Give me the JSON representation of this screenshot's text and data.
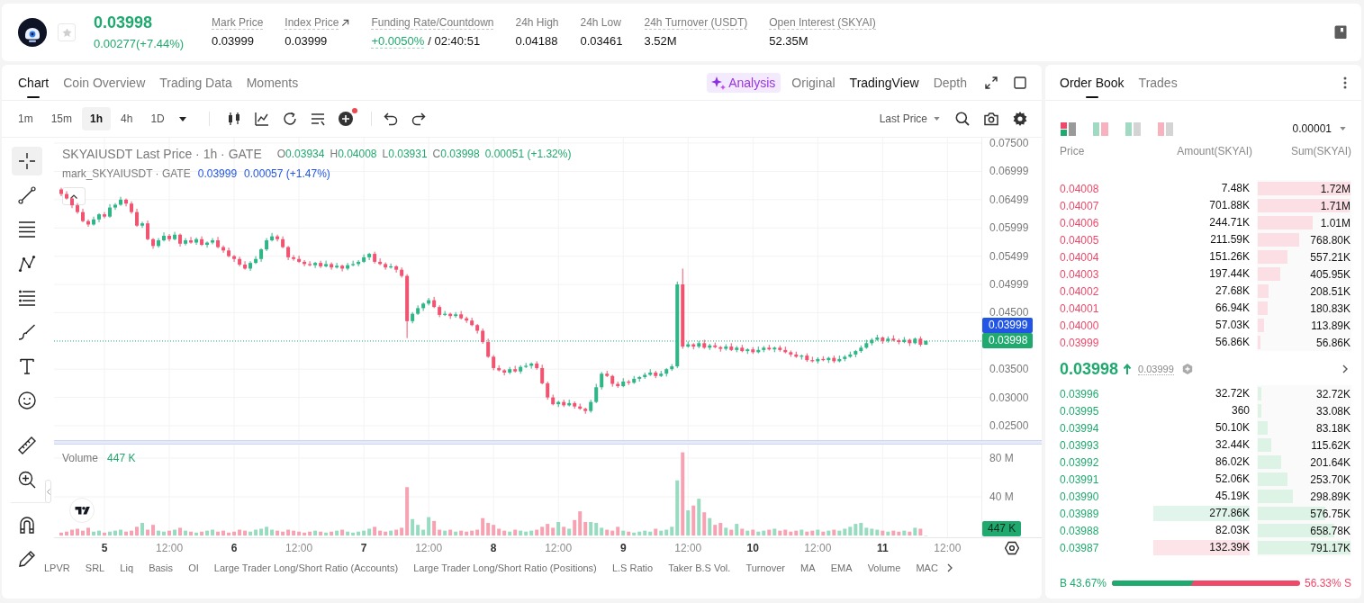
{
  "header": {
    "price": "0.03998",
    "change": "0.00277(+7.44%)",
    "favorite": false,
    "stats": [
      {
        "label": "Mark Price",
        "value": "0.03999",
        "hint": true,
        "kind": "plain"
      },
      {
        "label": "Index Price",
        "value": "0.03999",
        "hint": true,
        "kind": "link"
      },
      {
        "label": "Funding Rate/Countdown",
        "value": "+0.0050%",
        "extra": "/ 02:40:51",
        "hint": true,
        "kind": "funding"
      },
      {
        "label": "24h High",
        "value": "0.04188",
        "hint": false,
        "kind": "plain"
      },
      {
        "label": "24h Low",
        "value": "0.03461",
        "hint": false,
        "kind": "plain"
      },
      {
        "label": "24h Turnover (USDT)",
        "value": "3.52M",
        "hint": true,
        "kind": "plain"
      },
      {
        "label": "Open Interest (SKYAI)",
        "value": "52.35M",
        "hint": true,
        "kind": "plain"
      }
    ]
  },
  "chart_panel": {
    "tabs": [
      {
        "label": "Chart",
        "selected": true
      },
      {
        "label": "Coin Overview",
        "selected": false
      },
      {
        "label": "Trading Data",
        "selected": false
      },
      {
        "label": "Moments",
        "selected": false
      }
    ],
    "views": [
      {
        "label": "Analysis",
        "kind": "ai",
        "selected": false
      },
      {
        "label": "Original",
        "kind": "plain",
        "selected": false
      },
      {
        "label": "TradingView",
        "kind": "plain",
        "selected": true
      },
      {
        "label": "Depth",
        "kind": "plain",
        "selected": false
      }
    ],
    "intervals": [
      {
        "label": "1m",
        "selected": false
      },
      {
        "label": "15m",
        "selected": false
      },
      {
        "label": "1h",
        "selected": true
      },
      {
        "label": "4h",
        "selected": false
      },
      {
        "label": "1D",
        "selected": false
      }
    ],
    "indicator_alert": true,
    "price_source": "Last Price",
    "drawing_tools": [
      {
        "kind": "plain",
        "tools": [
          {
            "kind": "crosshair",
            "selected": true
          },
          {
            "kind": "line",
            "selected": false
          },
          {
            "kind": "hlines",
            "selected": false
          },
          {
            "kind": "pattern",
            "selected": false
          },
          {
            "kind": "fib",
            "selected": false
          },
          {
            "kind": "brush",
            "selected": false
          },
          {
            "kind": "text",
            "selected": false
          },
          {
            "kind": "emoji",
            "selected": false
          }
        ]
      },
      {
        "kind": "plain",
        "tools": [
          {
            "kind": "ruler",
            "selected": false
          },
          {
            "kind": "zoom",
            "selected": false
          }
        ]
      },
      {
        "kind": "divided",
        "tools": [
          {
            "kind": "magnet",
            "selected": false
          },
          {
            "kind": "pencil",
            "selected": false
          }
        ]
      }
    ],
    "price_chart": {
      "legend": {
        "title": "SKYAIUSDT Last Price · 1h · GATE",
        "ohlc": [
          {
            "key": "O",
            "value": "0.03934"
          },
          {
            "key": "H",
            "value": "0.04008"
          },
          {
            "key": "L",
            "value": "0.03931"
          },
          {
            "key": "C",
            "value": "0.03998"
          }
        ],
        "change": "0.00051 (+1.32%)"
      },
      "mark_legend": {
        "title": "mark_SKYAIUSDT · GATE",
        "value": "0.03999",
        "change": "0.00057 (+1.47%)"
      },
      "chart_data": {
        "type": "candlestick",
        "x": [
          4.6667,
          4.7083,
          4.75,
          4.7917,
          4.8333,
          4.875,
          4.9167,
          4.9583,
          5,
          5.0417,
          5.0833,
          5.125,
          5.1667,
          5.2083,
          5.25,
          5.2917,
          5.3333,
          5.375,
          5.4167,
          5.4583,
          5.5,
          5.5417,
          5.5833,
          5.625,
          5.6667,
          5.7083,
          5.75,
          5.7917,
          5.8333,
          5.875,
          5.9167,
          5.9583,
          6,
          6.0417,
          6.0833,
          6.125,
          6.1667,
          6.2083,
          6.25,
          6.2917,
          6.3333,
          6.375,
          6.4167,
          6.4583,
          6.5,
          6.5417,
          6.5833,
          6.625,
          6.6667,
          6.7083,
          6.75,
          6.7917,
          6.8333,
          6.875,
          6.9167,
          6.9583,
          7,
          7.0417,
          7.0833,
          7.125,
          7.1667,
          7.2083,
          7.25,
          7.2917,
          7.3333,
          7.375,
          7.4167,
          7.4583,
          7.5,
          7.5417,
          7.5833,
          7.625,
          7.6667,
          7.7083,
          7.75,
          7.7917,
          7.8333,
          7.875,
          7.9167,
          7.9583,
          8,
          8.0417,
          8.0833,
          8.125,
          8.1667,
          8.2083,
          8.25,
          8.2917,
          8.3333,
          8.375,
          8.4167,
          8.4583,
          8.5,
          8.5417,
          8.5833,
          8.625,
          8.6667,
          8.7083,
          8.75,
          8.7917,
          8.8333,
          8.875,
          8.9167,
          8.9583,
          9,
          9.0417,
          9.0833,
          9.125,
          9.1667,
          9.2083,
          9.25,
          9.2917,
          9.3333,
          9.375,
          9.4167,
          9.4583,
          9.5,
          9.5417,
          9.5833,
          9.625,
          9.6667,
          9.7083,
          9.75,
          9.7917,
          9.8333,
          9.875,
          9.9167,
          9.9583,
          10,
          10.0417,
          10.0833,
          10.125,
          10.1667,
          10.2083,
          10.25,
          10.2917,
          10.3333,
          10.375,
          10.4167,
          10.4583,
          10.5,
          10.5417,
          10.5833,
          10.625,
          10.6667,
          10.7083,
          10.75,
          10.7917,
          10.8333,
          10.875,
          10.9167,
          10.9583,
          11,
          11.0417,
          11.0833,
          11.125,
          11.1667,
          11.2083,
          11.25,
          11.2917,
          11.3333
        ],
        "ohlc": [
          [
            0.0668,
            0.0671,
            0.0656,
            0.066
          ],
          [
            0.066,
            0.0665,
            0.065,
            0.0652
          ],
          [
            0.0652,
            0.0654,
            0.0635,
            0.064
          ],
          [
            0.064,
            0.0644,
            0.0625,
            0.0628
          ],
          [
            0.0628,
            0.0634,
            0.061,
            0.0612
          ],
          [
            0.0612,
            0.0615,
            0.0602,
            0.0606
          ],
          [
            0.0606,
            0.062,
            0.0604,
            0.0615
          ],
          [
            0.0615,
            0.0626,
            0.061,
            0.0624
          ],
          [
            0.0624,
            0.0628,
            0.0617,
            0.062
          ],
          [
            0.062,
            0.0642,
            0.0618,
            0.0636
          ],
          [
            0.0636,
            0.0644,
            0.0632,
            0.0641
          ],
          [
            0.0641,
            0.0655,
            0.0639,
            0.065
          ],
          [
            0.065,
            0.0652,
            0.0638,
            0.0643
          ],
          [
            0.0643,
            0.0647,
            0.0625,
            0.0628
          ],
          [
            0.0628,
            0.0634,
            0.0602,
            0.0604
          ],
          [
            0.0604,
            0.0611,
            0.06,
            0.0608
          ],
          [
            0.0608,
            0.0613,
            0.0578,
            0.058
          ],
          [
            0.058,
            0.0582,
            0.0563,
            0.0568
          ],
          [
            0.0568,
            0.0582,
            0.0565,
            0.0578
          ],
          [
            0.0578,
            0.0592,
            0.0576,
            0.0586
          ],
          [
            0.0586,
            0.0589,
            0.0576,
            0.058
          ],
          [
            0.058,
            0.0593,
            0.0578,
            0.0588
          ],
          [
            0.0588,
            0.059,
            0.0567,
            0.0572
          ],
          [
            0.0572,
            0.0582,
            0.0569,
            0.0578
          ],
          [
            0.0578,
            0.0584,
            0.0572,
            0.0574
          ],
          [
            0.0574,
            0.0583,
            0.057,
            0.058
          ],
          [
            0.058,
            0.0585,
            0.0568,
            0.057
          ],
          [
            0.057,
            0.0576,
            0.0565,
            0.0574
          ],
          [
            0.0574,
            0.0582,
            0.0571,
            0.0578
          ],
          [
            0.0578,
            0.0584,
            0.0564,
            0.0566
          ],
          [
            0.0566,
            0.0569,
            0.0556,
            0.056
          ],
          [
            0.056,
            0.0565,
            0.0548,
            0.055
          ],
          [
            0.055,
            0.0552,
            0.054,
            0.0545
          ],
          [
            0.0545,
            0.0549,
            0.0532,
            0.0535
          ],
          [
            0.0535,
            0.0541,
            0.0526,
            0.0528
          ],
          [
            0.0528,
            0.0541,
            0.0524,
            0.0538
          ],
          [
            0.0538,
            0.055,
            0.0536,
            0.0545
          ],
          [
            0.0545,
            0.0564,
            0.054,
            0.0562
          ],
          [
            0.0562,
            0.0582,
            0.0559,
            0.0578
          ],
          [
            0.0578,
            0.0591,
            0.0576,
            0.0585
          ],
          [
            0.0585,
            0.0588,
            0.0576,
            0.058
          ],
          [
            0.058,
            0.0585,
            0.0564,
            0.0566
          ],
          [
            0.0566,
            0.0568,
            0.0543,
            0.0548
          ],
          [
            0.0548,
            0.0552,
            0.0542,
            0.0545
          ],
          [
            0.0545,
            0.0551,
            0.0538,
            0.054
          ],
          [
            0.054,
            0.0543,
            0.0532,
            0.0536
          ],
          [
            0.0536,
            0.0541,
            0.0532,
            0.0534
          ],
          [
            0.0534,
            0.054,
            0.0529,
            0.0538
          ],
          [
            0.0538,
            0.0542,
            0.0529,
            0.0532
          ],
          [
            0.0532,
            0.0542,
            0.053,
            0.0536
          ],
          [
            0.0536,
            0.0539,
            0.0526,
            0.053
          ],
          [
            0.053,
            0.0538,
            0.0528,
            0.0533
          ],
          [
            0.0533,
            0.0535,
            0.0523,
            0.0528
          ],
          [
            0.0528,
            0.0538,
            0.0525,
            0.0534
          ],
          [
            0.0534,
            0.0542,
            0.0532,
            0.0536
          ],
          [
            0.0536,
            0.0543,
            0.0532,
            0.054
          ],
          [
            0.054,
            0.0553,
            0.0538,
            0.0548
          ],
          [
            0.0548,
            0.0556,
            0.0543,
            0.0554
          ],
          [
            0.0554,
            0.0558,
            0.0537,
            0.054
          ],
          [
            0.054,
            0.0546,
            0.0534,
            0.0536
          ],
          [
            0.0536,
            0.0539,
            0.0526,
            0.053
          ],
          [
            0.053,
            0.0537,
            0.0528,
            0.0532
          ],
          [
            0.0532,
            0.0534,
            0.0521,
            0.0526
          ],
          [
            0.0526,
            0.053,
            0.0512,
            0.0515
          ],
          [
            0.0515,
            0.0518,
            0.0405,
            0.0435
          ],
          [
            0.0435,
            0.0451,
            0.0431,
            0.0448
          ],
          [
            0.0448,
            0.0463,
            0.0446,
            0.0458
          ],
          [
            0.0458,
            0.0468,
            0.0453,
            0.0466
          ],
          [
            0.0466,
            0.0476,
            0.0463,
            0.0472
          ],
          [
            0.0472,
            0.0478,
            0.0458,
            0.046
          ],
          [
            0.046,
            0.0463,
            0.0442,
            0.0446
          ],
          [
            0.0446,
            0.0453,
            0.0444,
            0.0448
          ],
          [
            0.0448,
            0.045,
            0.0439,
            0.0444
          ],
          [
            0.0444,
            0.0451,
            0.0441,
            0.0447
          ],
          [
            0.0447,
            0.0453,
            0.0438,
            0.044
          ],
          [
            0.044,
            0.0443,
            0.0432,
            0.0436
          ],
          [
            0.0436,
            0.0441,
            0.0426,
            0.0428
          ],
          [
            0.0428,
            0.043,
            0.0413,
            0.0418
          ],
          [
            0.0418,
            0.0422,
            0.0395,
            0.0398
          ],
          [
            0.0398,
            0.0404,
            0.037,
            0.0372
          ],
          [
            0.0372,
            0.0375,
            0.0348,
            0.0352
          ],
          [
            0.0352,
            0.0357,
            0.0346,
            0.0348
          ],
          [
            0.0348,
            0.035,
            0.0339,
            0.0344
          ],
          [
            0.0344,
            0.0354,
            0.0341,
            0.035
          ],
          [
            0.035,
            0.0356,
            0.0344,
            0.0346
          ],
          [
            0.0346,
            0.0357,
            0.0342,
            0.0354
          ],
          [
            0.0354,
            0.0361,
            0.0352,
            0.0356
          ],
          [
            0.0356,
            0.0362,
            0.0351,
            0.036
          ],
          [
            0.036,
            0.0364,
            0.0349,
            0.0352
          ],
          [
            0.0352,
            0.0358,
            0.0323,
            0.0325
          ],
          [
            0.0325,
            0.0328,
            0.0296,
            0.03
          ],
          [
            0.03,
            0.0305,
            0.0286,
            0.0288
          ],
          [
            0.0288,
            0.0294,
            0.0283,
            0.0292
          ],
          [
            0.0292,
            0.0296,
            0.0283,
            0.0286
          ],
          [
            0.0286,
            0.0296,
            0.0284,
            0.029
          ],
          [
            0.029,
            0.0293,
            0.028,
            0.0284
          ],
          [
            0.0284,
            0.0289,
            0.0278,
            0.028
          ],
          [
            0.028,
            0.0282,
            0.0271,
            0.0276
          ],
          [
            0.0276,
            0.0296,
            0.0273,
            0.0292
          ],
          [
            0.0292,
            0.0324,
            0.029,
            0.0318
          ],
          [
            0.0318,
            0.0345,
            0.0314,
            0.0342
          ],
          [
            0.0342,
            0.0347,
            0.0336,
            0.0338
          ],
          [
            0.0338,
            0.034,
            0.0319,
            0.0324
          ],
          [
            0.0324,
            0.0328,
            0.0317,
            0.032
          ],
          [
            0.032,
            0.0334,
            0.0318,
            0.0328
          ],
          [
            0.0328,
            0.0331,
            0.0322,
            0.0326
          ],
          [
            0.0326,
            0.0338,
            0.0324,
            0.0333
          ],
          [
            0.0333,
            0.0338,
            0.0328,
            0.0336
          ],
          [
            0.0336,
            0.0344,
            0.0333,
            0.034
          ],
          [
            0.034,
            0.035,
            0.0338,
            0.0344
          ],
          [
            0.0344,
            0.0347,
            0.0334,
            0.0338
          ],
          [
            0.0338,
            0.0347,
            0.0336,
            0.0342
          ],
          [
            0.0342,
            0.0352,
            0.0337,
            0.035
          ],
          [
            0.035,
            0.0359,
            0.0347,
            0.0355
          ],
          [
            0.0355,
            0.0505,
            0.0352,
            0.05
          ],
          [
            0.05,
            0.0528,
            0.0386,
            0.039
          ],
          [
            0.039,
            0.0399,
            0.0388,
            0.0394
          ],
          [
            0.0394,
            0.0396,
            0.0385,
            0.039
          ],
          [
            0.039,
            0.04,
            0.0387,
            0.0396
          ],
          [
            0.0396,
            0.0402,
            0.0386,
            0.0388
          ],
          [
            0.0388,
            0.0395,
            0.0384,
            0.0392
          ],
          [
            0.0392,
            0.0397,
            0.0387,
            0.0389
          ],
          [
            0.0389,
            0.0391,
            0.0381,
            0.0386
          ],
          [
            0.0386,
            0.0394,
            0.0383,
            0.039
          ],
          [
            0.039,
            0.0396,
            0.0382,
            0.0384
          ],
          [
            0.0384,
            0.0391,
            0.038,
            0.0388
          ],
          [
            0.0388,
            0.0393,
            0.038,
            0.0382
          ],
          [
            0.0382,
            0.0387,
            0.0377,
            0.0385
          ],
          [
            0.0385,
            0.0389,
            0.0377,
            0.038
          ],
          [
            0.038,
            0.039,
            0.0378,
            0.0384
          ],
          [
            0.0384,
            0.0391,
            0.038,
            0.0388
          ],
          [
            0.0388,
            0.0393,
            0.0383,
            0.0385
          ],
          [
            0.0385,
            0.039,
            0.038,
            0.0388
          ],
          [
            0.0388,
            0.0392,
            0.0381,
            0.0384
          ],
          [
            0.0384,
            0.039,
            0.0378,
            0.038
          ],
          [
            0.038,
            0.0383,
            0.0372,
            0.0376
          ],
          [
            0.0376,
            0.0381,
            0.037,
            0.0372
          ],
          [
            0.0372,
            0.0376,
            0.0367,
            0.0374
          ],
          [
            0.0374,
            0.0378,
            0.0363,
            0.0366
          ],
          [
            0.0366,
            0.0372,
            0.0362,
            0.0364
          ],
          [
            0.0364,
            0.0371,
            0.036,
            0.0368
          ],
          [
            0.0368,
            0.0373,
            0.0364,
            0.0366
          ],
          [
            0.0366,
            0.0372,
            0.0361,
            0.037
          ],
          [
            0.037,
            0.0374,
            0.0361,
            0.0364
          ],
          [
            0.0364,
            0.0374,
            0.0362,
            0.0368
          ],
          [
            0.0368,
            0.0375,
            0.0364,
            0.0372
          ],
          [
            0.0372,
            0.0381,
            0.037,
            0.0376
          ],
          [
            0.0376,
            0.0384,
            0.0371,
            0.0382
          ],
          [
            0.0382,
            0.0392,
            0.0379,
            0.0388
          ],
          [
            0.0388,
            0.0402,
            0.0386,
            0.0396
          ],
          [
            0.0396,
            0.0405,
            0.0392,
            0.0402
          ],
          [
            0.0402,
            0.0411,
            0.04,
            0.0406
          ],
          [
            0.0406,
            0.0408,
            0.0395,
            0.04
          ],
          [
            0.04,
            0.0408,
            0.0397,
            0.0404
          ],
          [
            0.0404,
            0.041,
            0.0399,
            0.0401
          ],
          [
            0.0401,
            0.0404,
            0.0394,
            0.0398
          ],
          [
            0.0398,
            0.0407,
            0.0396,
            0.0402
          ],
          [
            0.0402,
            0.0404,
            0.0391,
            0.0396
          ],
          [
            0.0396,
            0.0406,
            0.0394,
            0.0404
          ],
          [
            0.0404,
            0.0408,
            0.039,
            0.03934
          ],
          [
            0.03934,
            0.04008,
            0.03931,
            0.03998
          ]
        ],
        "xlim": [
          4.6111,
          12.2264
        ],
        "ylim": [
          0.02245,
          0.07596
        ],
        "grid": true,
        "yticks": [
          {
            "value": 0.075,
            "label": "0.07500"
          },
          {
            "value": 0.06999,
            "label": "0.06999"
          },
          {
            "value": 0.06499,
            "label": "0.06499"
          },
          {
            "value": 0.05999,
            "label": "0.05999"
          },
          {
            "value": 0.05499,
            "label": "0.05499"
          },
          {
            "value": 0.04999,
            "label": "0.04999"
          },
          {
            "value": 0.045,
            "label": "0.04500"
          },
          {
            "value": 0.035,
            "label": "0.03500"
          },
          {
            "value": 0.03,
            "label": "0.03000"
          },
          {
            "value": 0.025,
            "label": "0.02500"
          }
        ],
        "ref_lines": [
          {
            "axis": "y",
            "value": 0.03998,
            "color": "#20a96f"
          }
        ]
      },
      "price_tags": [
        {
          "label": "0.03999",
          "color": "#2255e6"
        },
        {
          "label": "0.03998",
          "color": "#20a96f"
        }
      ]
    },
    "volume_chart": {
      "label": "Volume",
      "value": "447 K",
      "tag": "447 K",
      "chart_data": {
        "type": "bar",
        "x": [
          4.6667,
          4.7083,
          4.75,
          4.7917,
          4.8333,
          4.875,
          4.9167,
          4.9583,
          5,
          5.0417,
          5.0833,
          5.125,
          5.1667,
          5.2083,
          5.25,
          5.2917,
          5.3333,
          5.375,
          5.4167,
          5.4583,
          5.5,
          5.5417,
          5.5833,
          5.625,
          5.6667,
          5.7083,
          5.75,
          5.7917,
          5.8333,
          5.875,
          5.9167,
          5.9583,
          6,
          6.0417,
          6.0833,
          6.125,
          6.1667,
          6.2083,
          6.25,
          6.2917,
          6.3333,
          6.375,
          6.4167,
          6.4583,
          6.5,
          6.5417,
          6.5833,
          6.625,
          6.6667,
          6.7083,
          6.75,
          6.7917,
          6.8333,
          6.875,
          6.9167,
          6.9583,
          7,
          7.0417,
          7.0833,
          7.125,
          7.1667,
          7.2083,
          7.25,
          7.2917,
          7.3333,
          7.375,
          7.4167,
          7.4583,
          7.5,
          7.5417,
          7.5833,
          7.625,
          7.6667,
          7.7083,
          7.75,
          7.7917,
          7.8333,
          7.875,
          7.9167,
          7.9583,
          8,
          8.0417,
          8.0833,
          8.125,
          8.1667,
          8.2083,
          8.25,
          8.2917,
          8.3333,
          8.375,
          8.4167,
          8.4583,
          8.5,
          8.5417,
          8.5833,
          8.625,
          8.6667,
          8.7083,
          8.75,
          8.7917,
          8.8333,
          8.875,
          8.9167,
          8.9583,
          9,
          9.0417,
          9.0833,
          9.125,
          9.1667,
          9.2083,
          9.25,
          9.2917,
          9.3333,
          9.375,
          9.4167,
          9.4583,
          9.5,
          9.5417,
          9.5833,
          9.625,
          9.6667,
          9.7083,
          9.75,
          9.7917,
          9.8333,
          9.875,
          9.9167,
          9.9583,
          10,
          10.0417,
          10.0833,
          10.125,
          10.1667,
          10.2083,
          10.25,
          10.2917,
          10.3333,
          10.375,
          10.4167,
          10.4583,
          10.5,
          10.5417,
          10.5833,
          10.625,
          10.6667,
          10.7083,
          10.75,
          10.7917,
          10.8333,
          10.875,
          10.9167,
          10.9583,
          11,
          11.0417,
          11.0833,
          11.125,
          11.1667,
          11.2083,
          11.25,
          11.2917,
          11.3333
        ],
        "values": [
          3,
          4,
          6,
          7,
          5,
          8,
          4,
          5,
          3,
          4,
          5,
          6,
          4,
          5,
          9,
          13,
          6,
          11,
          5,
          4,
          5,
          6,
          8,
          5,
          4,
          3,
          4,
          5,
          6,
          4,
          5,
          3,
          4,
          6,
          5,
          4,
          6,
          7,
          9,
          6,
          5,
          4,
          6,
          5,
          4,
          3,
          4,
          5,
          4,
          3,
          4,
          5,
          6,
          4,
          3,
          4,
          5,
          7,
          9,
          5,
          4,
          5,
          6,
          8,
          50,
          17,
          11,
          6,
          19,
          15,
          6,
          5,
          6,
          4,
          5,
          4,
          5,
          6,
          18,
          13,
          11,
          7,
          5,
          4,
          6,
          5,
          4,
          5,
          6,
          9,
          12,
          8,
          14,
          9,
          7,
          16,
          25,
          14,
          14,
          13,
          8,
          6,
          5,
          9,
          5,
          4,
          3,
          4,
          5,
          4,
          7,
          5,
          6,
          9,
          57,
          86,
          26,
          31,
          38,
          24,
          18,
          11,
          13,
          8,
          6,
          12,
          7,
          5,
          6,
          4,
          5,
          6,
          7,
          5,
          6,
          4,
          5,
          6,
          4,
          5,
          6,
          4,
          5,
          6,
          5,
          7,
          9,
          12,
          13,
          8,
          7,
          6,
          5,
          4,
          5,
          4,
          5,
          4,
          8,
          7,
          0
        ],
        "xlim": [
          4.6111,
          12.2264
        ],
        "ylim": [
          0,
          94
        ],
        "grid": true,
        "xticks": [
          5,
          6,
          7,
          8,
          9,
          10,
          11
        ],
        "yticks": [
          {
            "value": 80,
            "label": "80 M"
          },
          {
            "value": 40,
            "label": "40 M"
          }
        ]
      },
      "midday_labels": [
        "12:00",
        "12:00",
        "12:00",
        "12:00",
        "12:00",
        "12:00",
        "12:00"
      ]
    },
    "indicators": [
      "LPVR",
      "SRL",
      "Liq",
      "Basis",
      "OI",
      "Large Trader Long/Short Ratio (Accounts)",
      "Large Trader Long/Short Ratio (Positions)",
      "L.S Ratio",
      "Taker B.S Vol.",
      "Turnover",
      "MA",
      "EMA",
      "Volume",
      "MAC"
    ]
  },
  "order_book": {
    "tabs": [
      {
        "label": "Order Book",
        "selected": true
      },
      {
        "label": "Trades",
        "selected": false
      }
    ],
    "layouts": [
      {
        "kind": "both",
        "selected": true
      },
      {
        "kind": "split",
        "selected": false
      },
      {
        "kind": "bids",
        "selected": false
      },
      {
        "kind": "asks",
        "selected": false
      }
    ],
    "precision": "0.00001",
    "columns": [
      "Price",
      "Amount(SKYAI)",
      "Sum(SKYAI)"
    ],
    "asks": [
      {
        "price": "0.04008",
        "amount": "7.48K",
        "sum": "1.72M",
        "level": 1
      },
      {
        "price": "0.04007",
        "amount": "701.88K",
        "sum": "1.71M",
        "level": 0.99
      },
      {
        "price": "0.04006",
        "amount": "244.71K",
        "sum": "1.01M",
        "level": 0.59
      },
      {
        "price": "0.04005",
        "amount": "211.59K",
        "sum": "768.80K",
        "level": 0.45
      },
      {
        "price": "0.04004",
        "amount": "151.26K",
        "sum": "557.21K",
        "level": 0.32
      },
      {
        "price": "0.04003",
        "amount": "197.44K",
        "sum": "405.95K",
        "level": 0.24
      },
      {
        "price": "0.04002",
        "amount": "27.68K",
        "sum": "208.51K",
        "level": 0.12
      },
      {
        "price": "0.04001",
        "amount": "66.94K",
        "sum": "180.83K",
        "level": 0.11
      },
      {
        "price": "0.04000",
        "amount": "57.03K",
        "sum": "113.89K",
        "level": 0.07
      },
      {
        "price": "0.03999",
        "amount": "56.86K",
        "sum": "56.86K",
        "level": 0.03
      }
    ],
    "last": {
      "price": "0.03998",
      "rising": true,
      "mark": "0.03999"
    },
    "bids": [
      {
        "price": "0.03996",
        "amount": "32.72K",
        "sum": "32.72K",
        "level": 0.04,
        "kind": "plain"
      },
      {
        "price": "0.03995",
        "amount": "360",
        "sum": "33.08K",
        "level": 0.04,
        "kind": "plain"
      },
      {
        "price": "0.03994",
        "amount": "50.10K",
        "sum": "83.18K",
        "level": 0.11,
        "kind": "plain"
      },
      {
        "price": "0.03993",
        "amount": "32.44K",
        "sum": "115.62K",
        "level": 0.15,
        "kind": "plain"
      },
      {
        "price": "0.03992",
        "amount": "86.02K",
        "sum": "201.64K",
        "level": 0.25,
        "kind": "plain"
      },
      {
        "price": "0.03991",
        "amount": "52.06K",
        "sum": "253.70K",
        "level": 0.32,
        "kind": "plain"
      },
      {
        "price": "0.03990",
        "amount": "45.19K",
        "sum": "298.89K",
        "level": 0.38,
        "kind": "plain"
      },
      {
        "price": "0.03989",
        "amount": "277.86K",
        "sum": "576.75K",
        "level": 0.73,
        "kind": "buywall"
      },
      {
        "price": "0.03988",
        "amount": "82.03K",
        "sum": "658.78K",
        "level": 0.83,
        "kind": "plain"
      },
      {
        "price": "0.03987",
        "amount": "132.39K",
        "sum": "791.17K",
        "level": 1,
        "kind": "sellwall"
      }
    ],
    "ratio": {
      "buy": "B 43.67%",
      "sell": "56.33% S",
      "level": 0.4367
    }
  }
}
